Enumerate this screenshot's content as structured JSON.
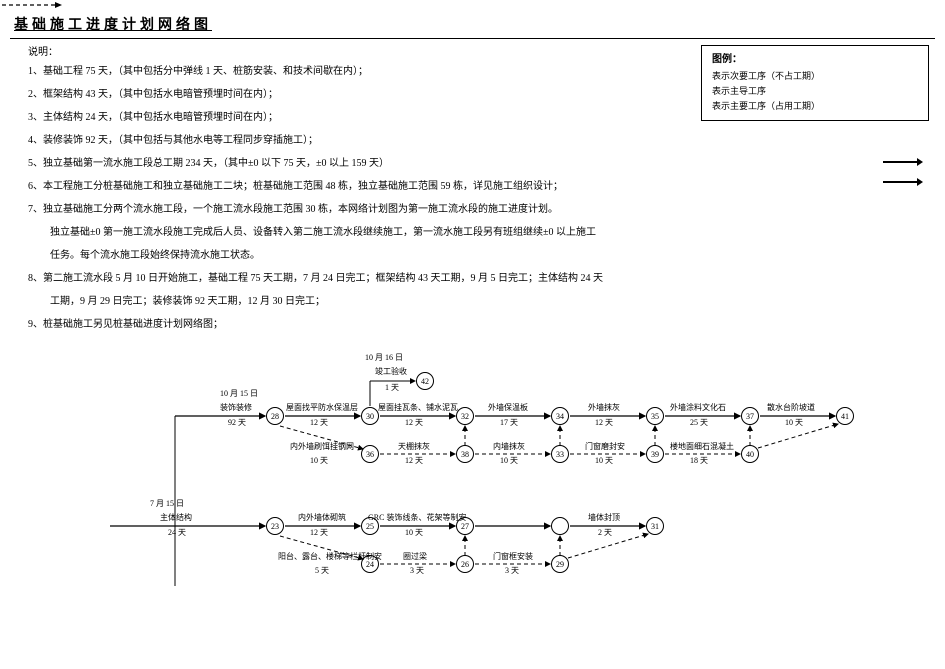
{
  "title": "基础施工进度计划网络图",
  "explain_title": "说明：",
  "explain_items": [
    "1、基础工程 75 天，（其中包括分中弹线 1 天、桩筋安装、和技术间歇在内）；",
    "2、框架结构 43 天，（其中包括水电暗管预埋时间在内）；",
    "3、主体结构 24 天，（其中包括水电暗管预埋时间在内）；",
    "4、装修装饰 92 天，（其中包括与其他水电等工程同步穿插施工）；",
    "5、独立基础第一流水施工段总工期 234 天，（其中±0 以下 75 天，±0 以上 159 天）",
    "6、本工程施工分桩基础施工和独立基础施工二块；桩基础施工范围 48 栋，独立基础施工范围 59 栋，详见施工组织设计；",
    "7、独立基础施工分两个流水施工段，一个施工流水段施工范围 30 栋，本网络计划图为第一施工流水段的施工进度计划。"
  ],
  "explain_indent": [
    "独立基础±0 第一施工流水段施工完成后人员、设备转入第二施工流水段继续施工，第一流水施工段另有班组继续±0 以上施工",
    "任务。每个流水施工段始终保持流水施工状态。"
  ],
  "explain_after": [
    "8、第二施工流水段 5 月 10 日开始施工，基础工程 75 天工期，7 月 24 日完工；框架结构 43 天工期，9 月 5 日完工；主体结构 24 天"
  ],
  "explain_indent2": [
    "工期，9 月 29 日完工；装修装饰 92 天工期，12 月 30 日完工；"
  ],
  "explain_last": "9、桩基础施工另见桩基础进度计划网络图；",
  "legend": {
    "title": "图例：",
    "sec": "表示次要工序（不占工期）",
    "main": "表示主导工序",
    "major_use": "表示主要工序（占用工期）"
  },
  "date_top": "10 月 15 日",
  "date_mid": "10 月 16 日",
  "date_left": "7 月 15 日",
  "top_row_left": {
    "a": "装饰装修",
    "b": "92 天"
  },
  "row1": [
    {
      "u": "屋面找平防水保温层",
      "d": "12 天"
    },
    {
      "u": "屋面挂瓦条、铺水泥瓦",
      "d": "12 天"
    },
    {
      "u": "外墙保温板",
      "d": "17 天"
    },
    {
      "u": "外墙抹灰",
      "d": "12 天"
    },
    {
      "u": "外墙涂料文化石",
      "d": "25 天"
    },
    {
      "u": "散水台阶坡道",
      "d": "10 天"
    }
  ],
  "row1a": {
    "u": "竣工验收",
    "d": "1 天"
  },
  "row2": [
    {
      "u": "内外墙刷饵挂钢网",
      "d": "10 天"
    },
    {
      "u": "天棚抹灰",
      "d": "12 天"
    },
    {
      "u": "内墙抹灰",
      "d": "10 天"
    },
    {
      "u": "门窗磨封安",
      "d": "10 天"
    },
    {
      "u": "楼地面细石混凝土",
      "d": "18 天"
    }
  ],
  "row3left": {
    "a": "主体结构",
    "b": "24 天"
  },
  "row3": [
    {
      "u": "内外墙体砌筑",
      "d": "12 天"
    },
    {
      "u": "GRC 装饰线条、花架等制安",
      "d": "10 天"
    },
    {
      "u": "",
      "d": ""
    },
    {
      "u": "墙体封顶",
      "d": "2 天"
    }
  ],
  "row4": [
    {
      "u": "阳台、露台、楼梯等栏杆制安",
      "d": "5 天"
    },
    {
      "u": "圈过梁",
      "d": "3 天"
    },
    {
      "u": "门窗框安装",
      "d": "3 天"
    }
  ]
}
